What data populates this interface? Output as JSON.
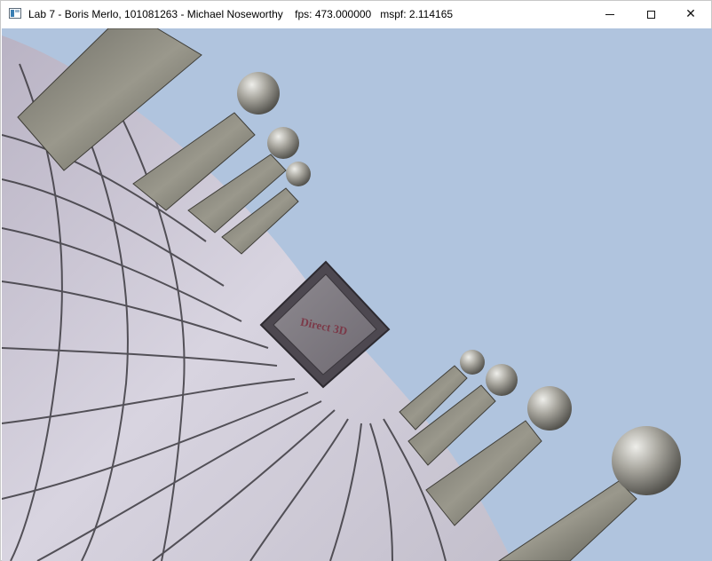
{
  "window": {
    "title": "Lab 7 - Boris Merlo, 101081263 - Michael Noseworthy    fps: 473.000000   mspf: 2.114165",
    "icon": "app-window-icon",
    "controls": {
      "minimize_icon": "minimize-icon",
      "maximize_icon": "maximize-icon",
      "close_icon": "close-icon",
      "close_glyph": "✕"
    }
  },
  "scene": {
    "sky_color": "#b0c4de",
    "floor_color": "#c9c4d2",
    "crate_label": "Direct 3D"
  }
}
